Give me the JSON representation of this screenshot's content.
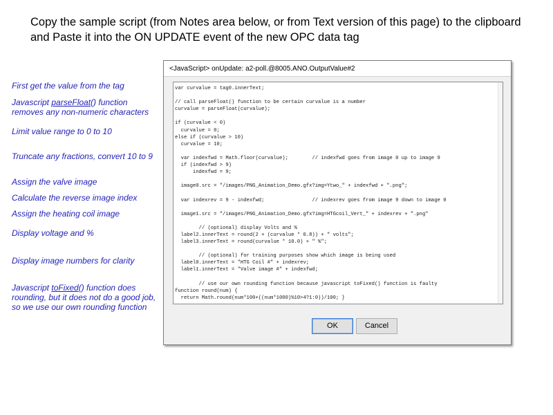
{
  "headline": "Copy the sample script (from Notes area below, or from Text version of this page) to the clipboard and Paste it into the ON UPDATE event of the new OPC data tag",
  "annotations": {
    "a1": "First get the value from the tag",
    "a2_pre": "Javascript ",
    "a2_link": "parseFloat",
    "a2_post": "() function removes any non-numeric characters",
    "a3": "Limit value range to 0 to 10",
    "a4": "Truncate any fractions, convert 10 to 9",
    "a5": "Assign the valve image",
    "a6": "Calculate the reverse image index",
    "a7": "Assign the heating coil image",
    "a8": "Display voltage and %",
    "a9": "Display image numbers for clarity",
    "a10_pre": "Javascript ",
    "a10_link": "toFixed",
    "a10_post": "() function does rounding, but it does not do a good job, so we use our own rounding function"
  },
  "dialog": {
    "title": "<JavaScript> onUpdate: a2-poll.@8005.ANO.OutputValue#2",
    "code": "var curvalue = tag0.innerText;\n\n// call parseFloat() function to be certain curvalue is a number\ncurvalue = parseFloat(curvalue);\n\nif (curvalue < 0)\n  curvalue = 0;\nelse if (curvalue > 10)\n  curvalue = 10;\n\n  var indexfwd = Math.floor(curvalue);        // indexfwd goes from image 0 up to image 9\n  if (indexfwd > 9)\n      indexfwd = 9;\n\n  image0.src = \"/images/PNG_Animation_Demo.gfx?img=Ytwo_\" + indexfwd + \".png\";\n\n  var indexrev = 9 - indexfwd;                // indexrev goes from image 9 down to image 0\n\n  image1.src = \"/images/PNG_Animation_Demo.gfx?img=HTGcoil_Vert_\" + indexrev + \".png\"\n\n        // (optional) display Volts and %\n  label2.innerText = round(2 + (curvalue * 0.8)) + \" volts\";\n  label3.innerText = round(curvalue * 10.0) + \" %\";\n\n        // (optional) for training purposes show which image is being used\n  label0.innerText = \"HTG Coil #\" + indexrev;\n  label1.innerText = \"Valve image #\" + indexfwd;\n\n        // use our own rounding function because javascript toFixed() function is faulty\nfunction round(num) {\n  return Math.round(num*100+((num*1000)%10>4?1:0))/100; }",
    "ok_label": "OK",
    "cancel_label": "Cancel"
  }
}
